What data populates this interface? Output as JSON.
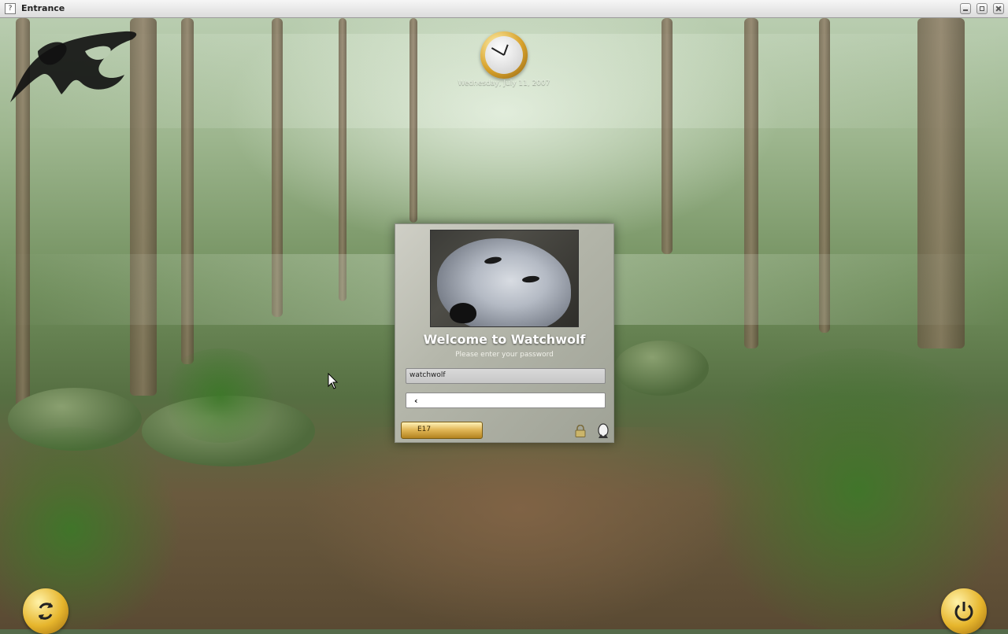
{
  "window": {
    "title": "Entrance"
  },
  "clock": {
    "date": "Wednesday, July 11, 2007"
  },
  "login": {
    "welcome": "Welcome to Watchwolf",
    "prompt": "Please enter your password",
    "username_value": "watchwolf",
    "password_value": "",
    "session_label": "E17"
  },
  "icons": {
    "app": "app-icon",
    "minimize": "minimize-icon",
    "maximize": "maximize-icon",
    "close": "close-icon",
    "clock": "clock-icon",
    "lock": "lock-icon",
    "user": "user-icon",
    "reload": "reload-icon",
    "power": "power-icon"
  },
  "colors": {
    "accent_gold": "#e3b95a",
    "dialog_gray": "#b5b7ab"
  }
}
